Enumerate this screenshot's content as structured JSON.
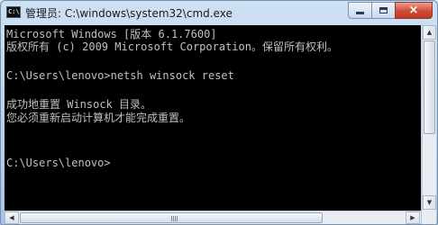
{
  "window": {
    "title": "管理员: C:\\windows\\system32\\cmd.exe",
    "icon_label": "C:\\"
  },
  "controls": {
    "minimize": "minimize",
    "maximize": "maximize",
    "close": "×"
  },
  "console": {
    "text_color": "#c0c0c0",
    "background": "#000000",
    "lines": [
      "Microsoft Windows [版本 6.1.7600]",
      "版权所有 (c) 2009 Microsoft Corporation。保留所有权利。",
      "",
      "C:\\Users\\lenovo>netsh winsock reset",
      "",
      "成功地重置 Winsock 目录。",
      "您必须重新启动计算机才能完成重置。",
      "",
      "",
      "",
      "C:\\Users\\lenovo>"
    ]
  },
  "scrollbars": {
    "up": "▲",
    "down": "▼",
    "left": "◀",
    "right": "▶"
  }
}
